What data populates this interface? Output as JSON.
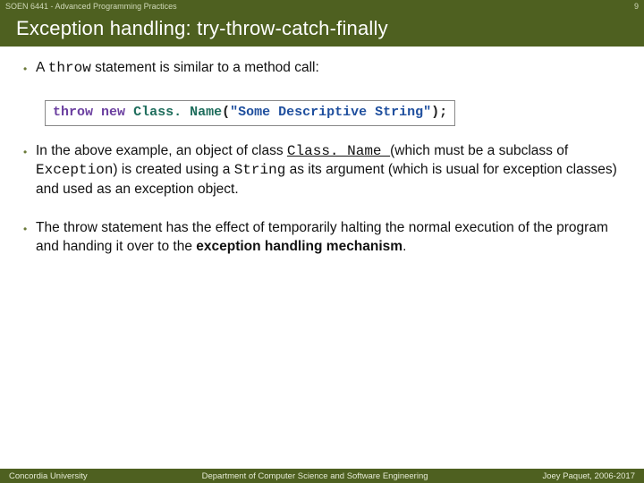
{
  "header": {
    "course": "SOEN 6441 - Advanced Programming Practices",
    "page_number": "9"
  },
  "title": "Exception handling: try-throw-catch-finally",
  "bullets": [
    {
      "pre": "A ",
      "mono": "throw",
      "post": " statement is similar to a method call:"
    },
    {
      "full": "In the above example, an object of class ",
      "cls": "Class. Name ",
      "mid1": "(which must be a subclass of ",
      "exc": "Exception",
      "mid2": ") is created using a ",
      "str": "String",
      "mid3": " as its argument (which is usual for exception classes) and used as an exception object."
    },
    {
      "pre": "The throw statement has the effect of temporarily halting the normal execution of the program and handing it over to the ",
      "bold": "exception handling mechanism",
      "post": "."
    }
  ],
  "code": {
    "kw_throw": "throw",
    "space1": " ",
    "kw_new": "new",
    "space2": " ",
    "classname": "Class. Name",
    "lparen": "(",
    "string": "\"Some Descriptive String\"",
    "rparen_semi": ");"
  },
  "footer": {
    "left": "Concordia University",
    "center": "Department of Computer Science and Software Engineering",
    "right": "Joey Paquet, 2006-2017"
  }
}
